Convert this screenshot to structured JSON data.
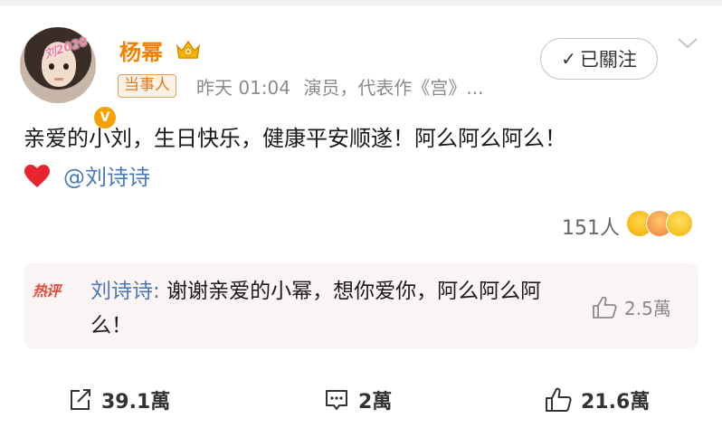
{
  "post": {
    "avatar_stamp": "刘2020",
    "verified_badge": "V",
    "user_name": "杨幂",
    "party_badge": "当事人",
    "time": "昨天 01:04",
    "bio": "演员，代表作《宫》...",
    "follow_label": "已關注",
    "text_line_1": "亲爱的小刘，生日快乐，健康平安顺遂！阿么阿么阿么！",
    "mention": "@刘诗诗",
    "reaction_count": "151人"
  },
  "hot_comment": {
    "tag": "热评",
    "commenter": "刘诗诗",
    "separator": ": ",
    "text": "谢谢亲爱的小幂，想你爱你，阿么阿么阿么！",
    "likes": "2.5萬"
  },
  "actions": {
    "repost": "39.1萬",
    "comment": "2萬",
    "like": "21.6萬"
  },
  "colors": {
    "name": "#f08200",
    "link": "#4a79b8",
    "hot_tag": "#e74a3c",
    "comment_bg": "#fbf4f4"
  },
  "icons": [
    "crown-icon",
    "check-icon",
    "chevron-down-icon",
    "heart-icon",
    "emoji-laugh-icon",
    "emoji-wink-icon",
    "emoji-wow-icon",
    "thumbs-up-icon",
    "repost-icon",
    "comment-icon"
  ]
}
